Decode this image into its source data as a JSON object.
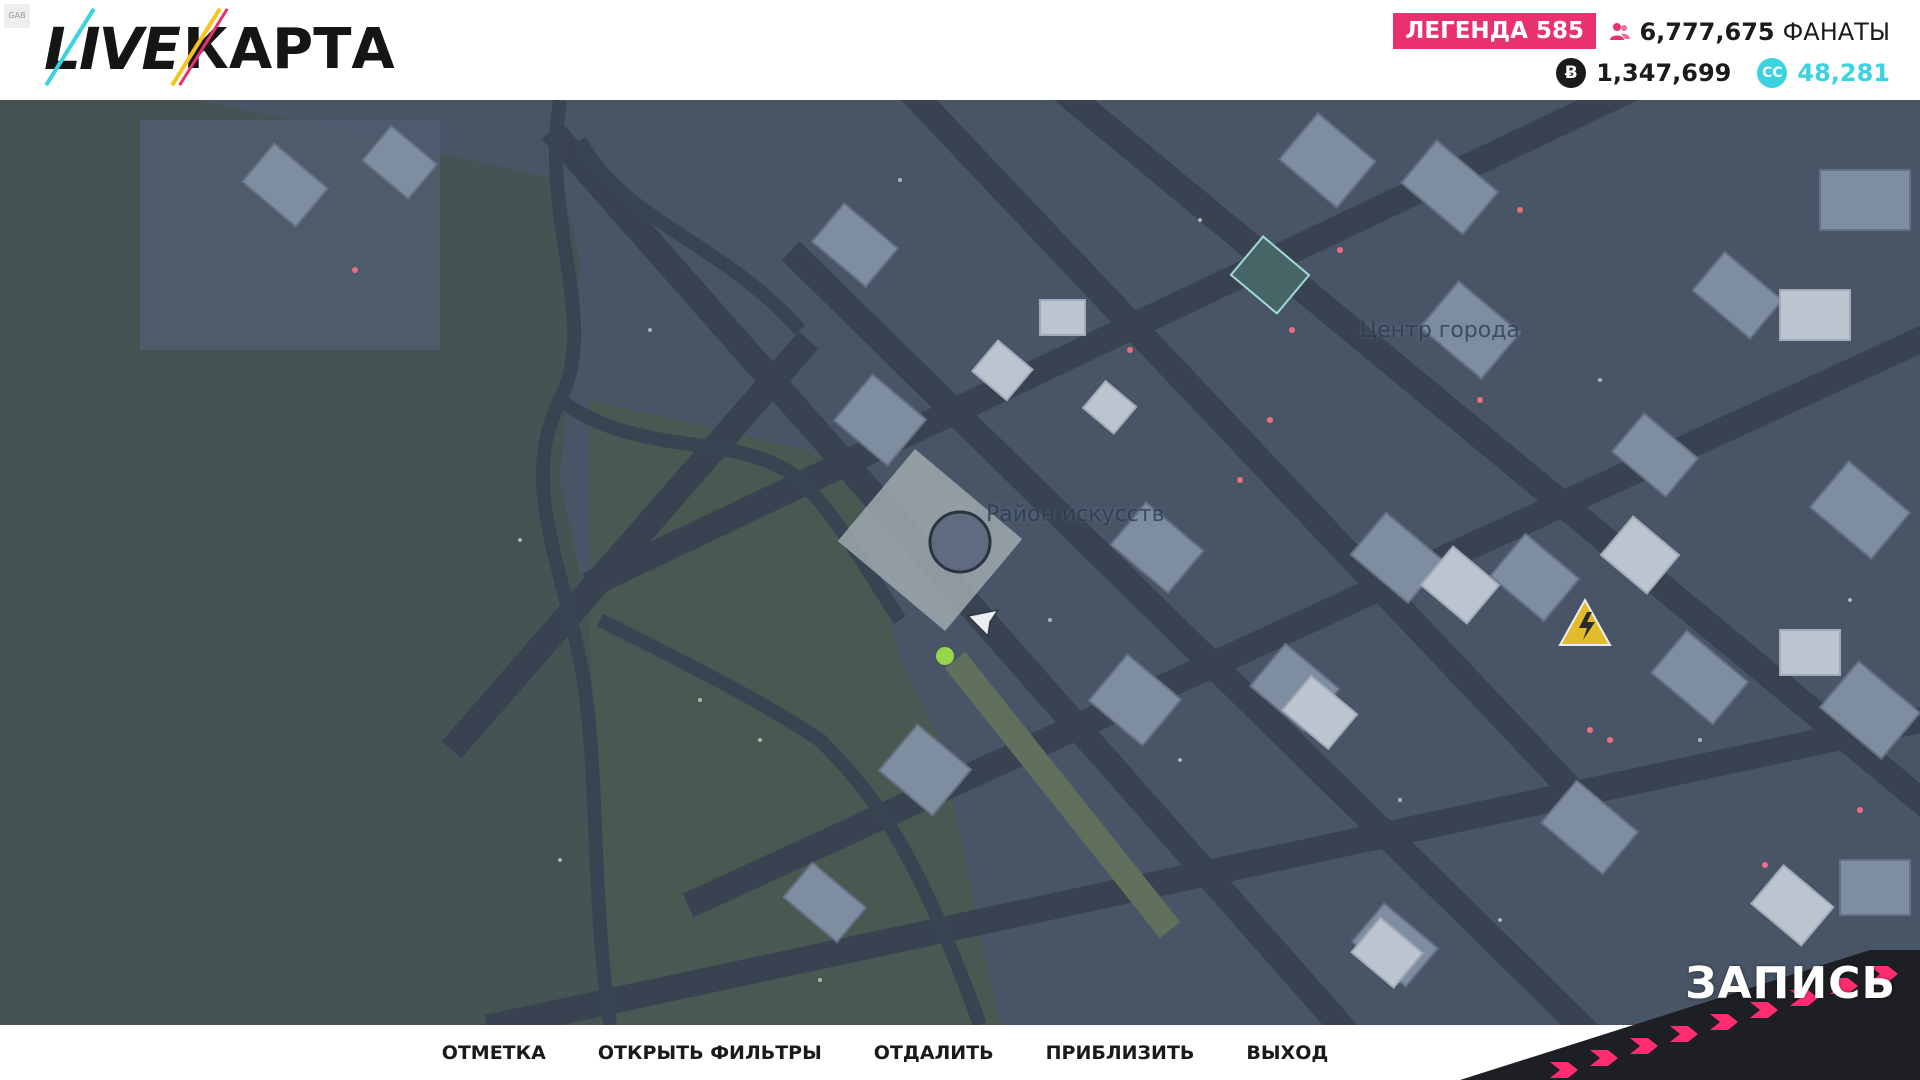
{
  "header": {
    "logo_live": "LIVE",
    "logo_karta": "КАРТА",
    "small_badge": "GAB"
  },
  "stats": {
    "legend_label": "ЛЕГЕНДА",
    "legend_value": "585",
    "fans_value": "6,777,675",
    "fans_label": "ФАНАТЫ",
    "bitcoin_value": "1,347,699",
    "cc_value": "48,281",
    "bitcoin_symbol": "Ƀ",
    "cc_symbol": "CC"
  },
  "map": {
    "districts": [
      {
        "name": "Центр города"
      },
      {
        "name": "Район искусств"
      }
    ],
    "markers": [
      "player-cursor-icon",
      "waypoint-dot-icon",
      "power-hazard-icon",
      "circle-objective-icon"
    ]
  },
  "actions": [
    "ОТМЕТКА",
    "ОТКРЫТЬ ФИЛЬТРЫ",
    "ОТДАЛИТЬ",
    "ПРИБЛИЗИТЬ",
    "ВЫХОД"
  ],
  "recording": {
    "label": "ЗАПИСЬ"
  },
  "colors": {
    "legend_bg": "#e8316e",
    "cc_accent": "#3bd3e0",
    "map_ground": "#39465a",
    "forest": "#3b4b45",
    "hazard": "#f5c518",
    "waypoint": "#9be33a",
    "rec_stripe": "#ff2d6f"
  }
}
